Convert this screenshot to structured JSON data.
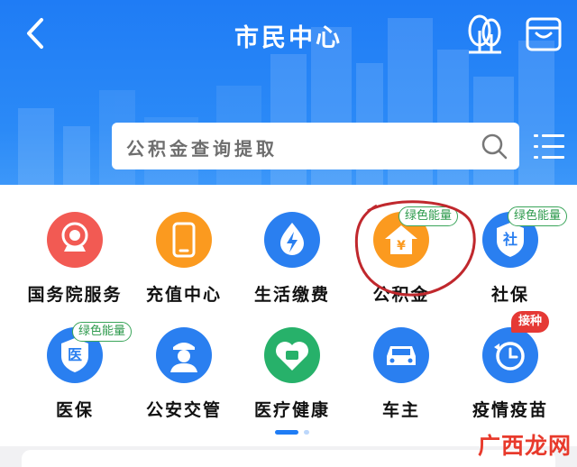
{
  "header": {
    "title": "市民中心",
    "search_placeholder": "公积金查询提取"
  },
  "services": [
    {
      "label": "国务院服务",
      "icon": "national-emblem-icon",
      "color": "#f25a53"
    },
    {
      "label": "充值中心",
      "icon": "phone-icon",
      "color": "#fb9a1f"
    },
    {
      "label": "生活缴费",
      "icon": "lightning-icon",
      "color": "#2a7ff0"
    },
    {
      "label": "公积金",
      "icon": "house-yuan-icon",
      "color": "#fb9a1f",
      "badge": "绿色能量"
    },
    {
      "label": "社保",
      "icon": "social-security-shield-icon",
      "color": "#2a7ff0",
      "badge": "绿色能量",
      "icon_text": "社"
    },
    {
      "label": "医保",
      "icon": "medical-shield-icon",
      "color": "#2a7ff0",
      "badge": "绿色能量",
      "icon_text": "医"
    },
    {
      "label": "公安交管",
      "icon": "police-icon",
      "color": "#2a7ff0"
    },
    {
      "label": "医疗健康",
      "icon": "health-heart-icon",
      "color": "#27b16a"
    },
    {
      "label": "车主",
      "icon": "car-icon",
      "color": "#2a7ff0"
    },
    {
      "label": "疫情疫苗",
      "icon": "clock-refresh-icon",
      "color": "#2a7ff0",
      "badge_red": "接种"
    }
  ],
  "watermark": "广西龙网",
  "colors": {
    "header_blue": "#1f7cf5",
    "green_badge": "#3aa55a",
    "red_badge": "#e53935",
    "annotation": "#c0282d"
  }
}
